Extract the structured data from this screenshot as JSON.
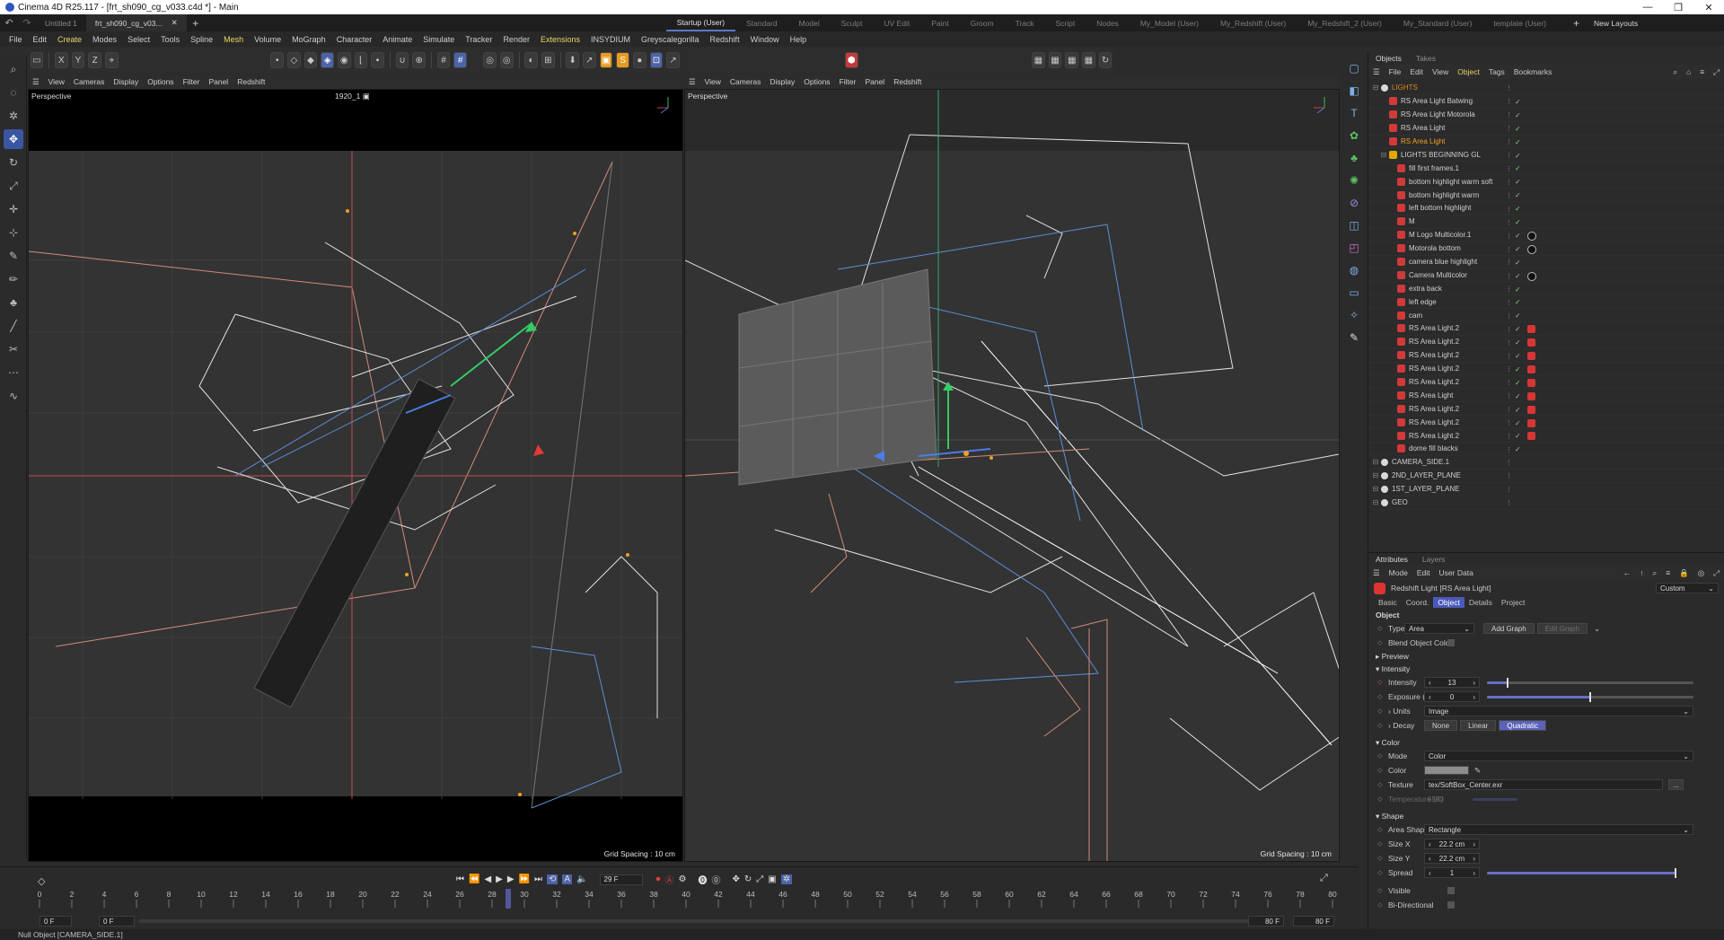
{
  "window": {
    "title": "Cinema 4D R25.117 - [frt_sh090_cg_v033.c4d *] - Main",
    "controls": [
      "—",
      "❐",
      "✕"
    ]
  },
  "doc_tabs": [
    {
      "label": "Untitled 1"
    },
    {
      "label": "frt_sh090_cg_v03..."
    }
  ],
  "layout_tabs": [
    "Startup (User)",
    "Standard",
    "Model",
    "Sculpt",
    "UV Edit",
    "Paint",
    "Groom",
    "Track",
    "Script",
    "Nodes",
    "My_Model (User)",
    "My_Redshift (User)",
    "My_Redshift_2 (User)",
    "My_Standard (User)",
    "template (User)"
  ],
  "new_layouts": "New Layouts",
  "main_menu": [
    "File",
    "Edit",
    "Create",
    "Modes",
    "Select",
    "Tools",
    "Spline",
    "Mesh",
    "Volume",
    "MoGraph",
    "Character",
    "Animate",
    "Simulate",
    "Tracker",
    "Render",
    "Extensions",
    "INSYDIUM",
    "Greyscalegorilla",
    "Redshift",
    "Window",
    "Help"
  ],
  "toolbar": {
    "x": "X",
    "y": "Y",
    "z": "Z"
  },
  "viewport_left": {
    "menu": [
      "View",
      "Cameras",
      "Display",
      "Options",
      "Filter",
      "Panel",
      "Redshift"
    ],
    "label": "Perspective",
    "camera": "1920_1",
    "grid": "Grid Spacing : 10 cm"
  },
  "viewport_right": {
    "menu": [
      "View",
      "Cameras",
      "Display",
      "Options",
      "Filter",
      "Panel",
      "Redshift"
    ],
    "label": "Perspective",
    "grid": "Grid Spacing : 10 cm"
  },
  "timeline": {
    "ticks": [
      "0",
      "2",
      "4",
      "6",
      "8",
      "10",
      "12",
      "14",
      "16",
      "18",
      "20",
      "22",
      "24",
      "26",
      "28",
      "30",
      "32",
      "34",
      "36",
      "38",
      "40",
      "42",
      "44",
      "46",
      "48",
      "50",
      "52",
      "54",
      "56",
      "58",
      "60",
      "62",
      "64",
      "66",
      "68",
      "70",
      "72",
      "74",
      "76",
      "78",
      "80"
    ],
    "current_frame": "29",
    "frame_field": "29 F",
    "start": "0 F",
    "start2": "0 F",
    "end": "80 F",
    "end2": "80 F"
  },
  "status": "Null Object [CAMERA_SIDE.1]",
  "objects_panel": {
    "tabs": [
      "Objects",
      "Takes"
    ],
    "menu": [
      "File",
      "Edit",
      "View",
      "Object",
      "Tags",
      "Bookmarks"
    ],
    "rows": [
      {
        "name": "LIGHTS",
        "indent": 0,
        "kind": "null",
        "parent": true
      },
      {
        "name": "RS Area Light Batwing",
        "indent": 1,
        "kind": "light"
      },
      {
        "name": "RS Area Light Motorola",
        "indent": 1,
        "kind": "light"
      },
      {
        "name": "RS Area Light",
        "indent": 1,
        "kind": "light"
      },
      {
        "name": "RS Area Light",
        "indent": 1,
        "kind": "light",
        "selected": true
      },
      {
        "name": "LIGHTS BEGINNING GL",
        "indent": 1,
        "kind": "folder"
      },
      {
        "name": "fill first frames.1",
        "indent": 2,
        "kind": "light"
      },
      {
        "name": "bottom highlight warm soft",
        "indent": 2,
        "kind": "light"
      },
      {
        "name": "bottom highlight warm",
        "indent": 2,
        "kind": "light"
      },
      {
        "name": "left bottom highlight",
        "indent": 2,
        "kind": "light"
      },
      {
        "name": "M",
        "indent": 2,
        "kind": "light"
      },
      {
        "name": "M Logo Multicolor.1",
        "indent": 2,
        "kind": "light",
        "tag": "black"
      },
      {
        "name": "Motorola bottom",
        "indent": 2,
        "kind": "light",
        "tag": "black"
      },
      {
        "name": "camera blue highlight",
        "indent": 2,
        "kind": "light"
      },
      {
        "name": "Camera Multicolor",
        "indent": 2,
        "kind": "light",
        "tag": "black"
      },
      {
        "name": "extra back",
        "indent": 2,
        "kind": "light"
      },
      {
        "name": "left edge",
        "indent": 2,
        "kind": "light"
      },
      {
        "name": "cam",
        "indent": 2,
        "kind": "light"
      },
      {
        "name": "RS Area Light.2",
        "indent": 2,
        "kind": "light",
        "tag": "red"
      },
      {
        "name": "RS Area Light.2",
        "indent": 2,
        "kind": "light",
        "tag": "red"
      },
      {
        "name": "RS Area Light.2",
        "indent": 2,
        "kind": "light",
        "tag": "red"
      },
      {
        "name": "RS Area Light.2",
        "indent": 2,
        "kind": "light",
        "tag": "red"
      },
      {
        "name": "RS Area Light.2",
        "indent": 2,
        "kind": "light",
        "tag": "red"
      },
      {
        "name": "RS Area Light",
        "indent": 2,
        "kind": "light",
        "tag": "red"
      },
      {
        "name": "RS Area Light.2",
        "indent": 2,
        "kind": "light",
        "tag": "red"
      },
      {
        "name": "RS Area Light.2",
        "indent": 2,
        "kind": "light",
        "tag": "red"
      },
      {
        "name": "RS Area Light.2",
        "indent": 2,
        "kind": "light",
        "tag": "red"
      },
      {
        "name": "dome fill blacks",
        "indent": 2,
        "kind": "light"
      },
      {
        "name": "CAMERA_SIDE.1",
        "indent": 0,
        "kind": "null"
      },
      {
        "name": "2ND_LAYER_PLANE",
        "indent": 0,
        "kind": "null"
      },
      {
        "name": "1ST_LAYER_PLANE",
        "indent": 0,
        "kind": "null"
      },
      {
        "name": "GEO",
        "indent": 0,
        "kind": "null"
      }
    ]
  },
  "attributes_panel": {
    "tabs": [
      "Attributes",
      "Layers"
    ],
    "menu": [
      "Mode",
      "Edit",
      "User Data"
    ],
    "object_title": "Redshift Light [RS Area Light]",
    "preset": "Custom",
    "subtabs": [
      "Basic",
      "Coord.",
      "Object",
      "Details",
      "Project"
    ],
    "section_object": "Object",
    "type_label": "Type",
    "type_value": "Area",
    "add_graph": "Add Graph",
    "edit_graph": "Edit Graph",
    "blend_object_color": "Blend Object Color",
    "preview": "Preview",
    "intensity_section": "Intensity",
    "intensity_label": "Intensity",
    "intensity_value": "13",
    "intensity_fraction": 0.1,
    "exposure_label": "Exposure (EV)",
    "exposure_value": "0",
    "exposure_fraction": 0.5,
    "units_label": "Units",
    "units_value": "Image",
    "decay_label": "Decay",
    "decay_options": [
      "None",
      "Linear",
      "Quadratic"
    ],
    "color_section": "Color",
    "mode_label": "Mode",
    "mode_value": "Color",
    "color_label": "Color",
    "texture_label": "Texture",
    "texture_value": "tex/SoftBox_Center.exr",
    "texture_btn": "...",
    "temperature_label": "Temperature (K)",
    "temperature_value": "6500",
    "shape_section": "Shape",
    "area_shape_label": "Area Shape",
    "area_shape_value": "Rectangle",
    "sizex_label": "Size X",
    "sizex_value": "22.2 cm",
    "sizey_label": "Size Y",
    "sizey_value": "22.2 cm",
    "spread_label": "Spread",
    "spread_value": "1",
    "spread_fraction": 1.0,
    "visible_label": "Visible",
    "bidirectional_label": "Bi-Directional"
  }
}
